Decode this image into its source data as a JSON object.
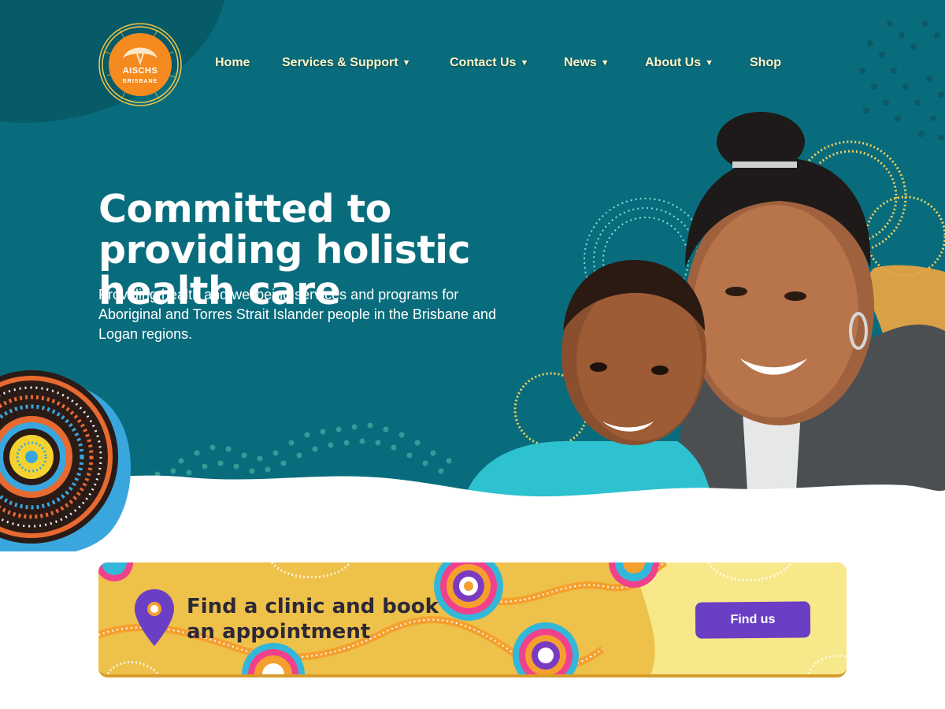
{
  "brand": {
    "logo_text": "AISCHS",
    "logo_subtext": "BRISBANE"
  },
  "nav": {
    "items": [
      {
        "label": "Home",
        "has_dropdown": false
      },
      {
        "label": "Services & Support",
        "has_dropdown": true
      },
      {
        "label": "Contact Us",
        "has_dropdown": true
      },
      {
        "label": "News",
        "has_dropdown": true
      },
      {
        "label": "About Us",
        "has_dropdown": true
      },
      {
        "label": "Shop",
        "has_dropdown": false
      }
    ],
    "dropdown_glyph": "▼"
  },
  "hero": {
    "title": "Committed to providing holistic health care",
    "subtitle": "Providing health and wellbeing services and programs for Aboriginal and Torres Strait Islander people in the Brisbane and Logan regions."
  },
  "clinic": {
    "title": "Find a clinic and book an appointment",
    "button_label": "Find us",
    "icon": "map-pin-icon"
  },
  "colors": {
    "hero_bg": "#096c7c",
    "nav_text": "#fff6c9",
    "banner_bg": "#eec14a",
    "button_bg": "#6a3fc4",
    "logo_orange": "#f58a1f"
  }
}
